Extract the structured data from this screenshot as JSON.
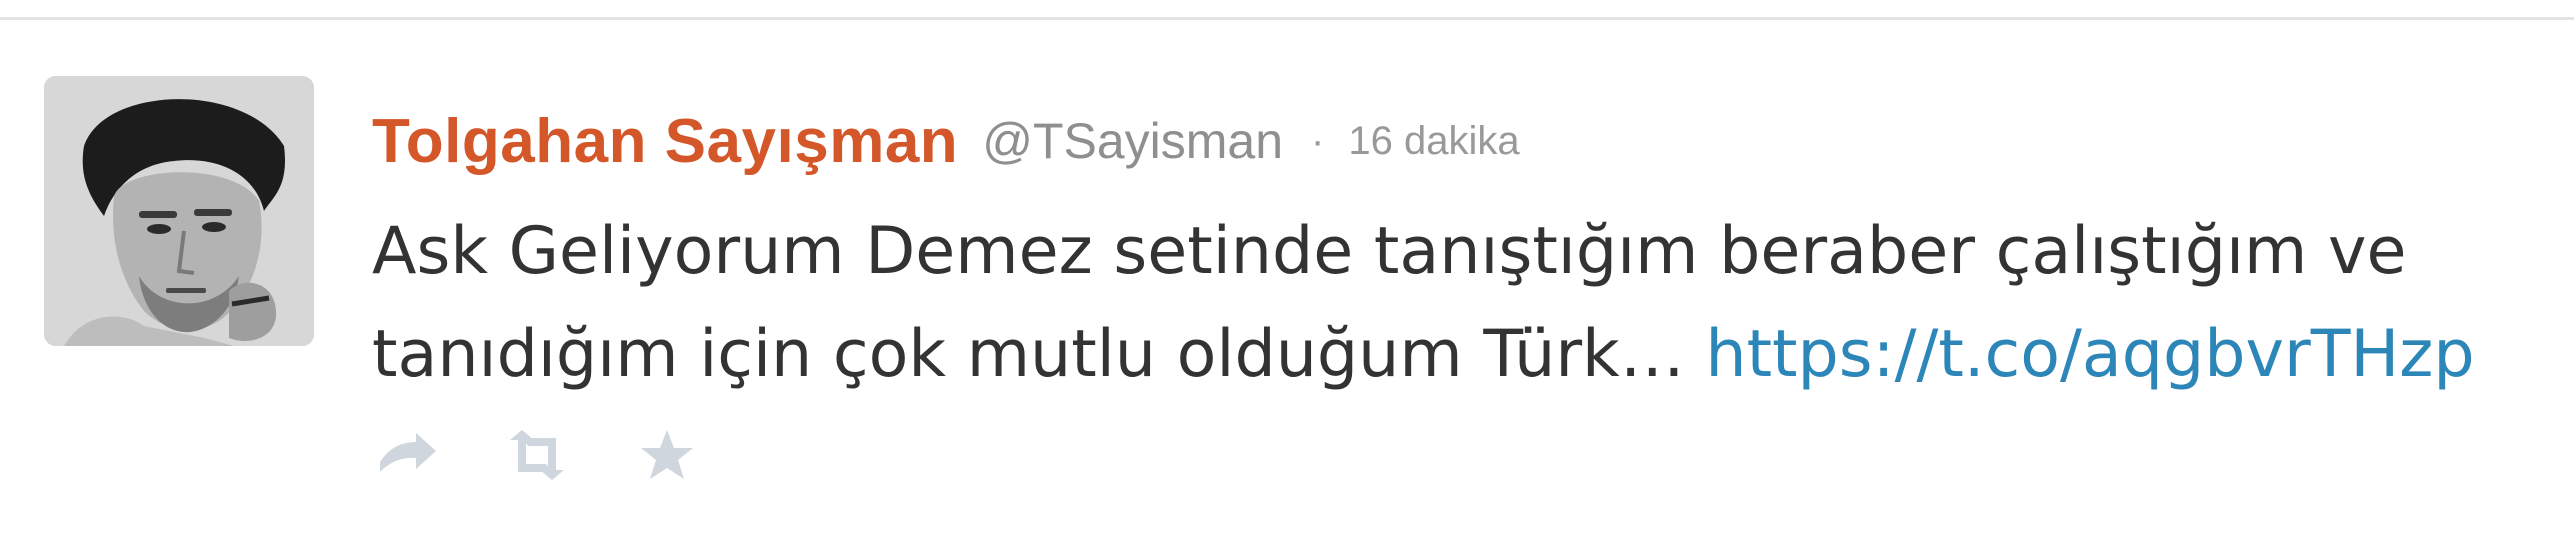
{
  "tweet": {
    "author_name": "Tolgahan Sayışman",
    "author_handle": "@TSayisman",
    "separator": "·",
    "timestamp": "16 dakika",
    "text_line_1": "Ask Geliyorum Demez setinde tanıştığım beraber çalıştığım ve",
    "text_line_2": "tanıdığım için çok mutlu olduğum Türk…",
    "link": "https://t.co/aqgbvrTHzp"
  },
  "actions": [
    {
      "icon": "reply-icon"
    },
    {
      "icon": "retweet-icon"
    },
    {
      "icon": "favorite-star-icon"
    }
  ],
  "colors": {
    "name": "#d4572a",
    "handle": "#8f8f8f",
    "text": "#333333",
    "link": "#2d86b8",
    "action_icons": "#cfd6dd",
    "divider": "#e3e3e3"
  }
}
